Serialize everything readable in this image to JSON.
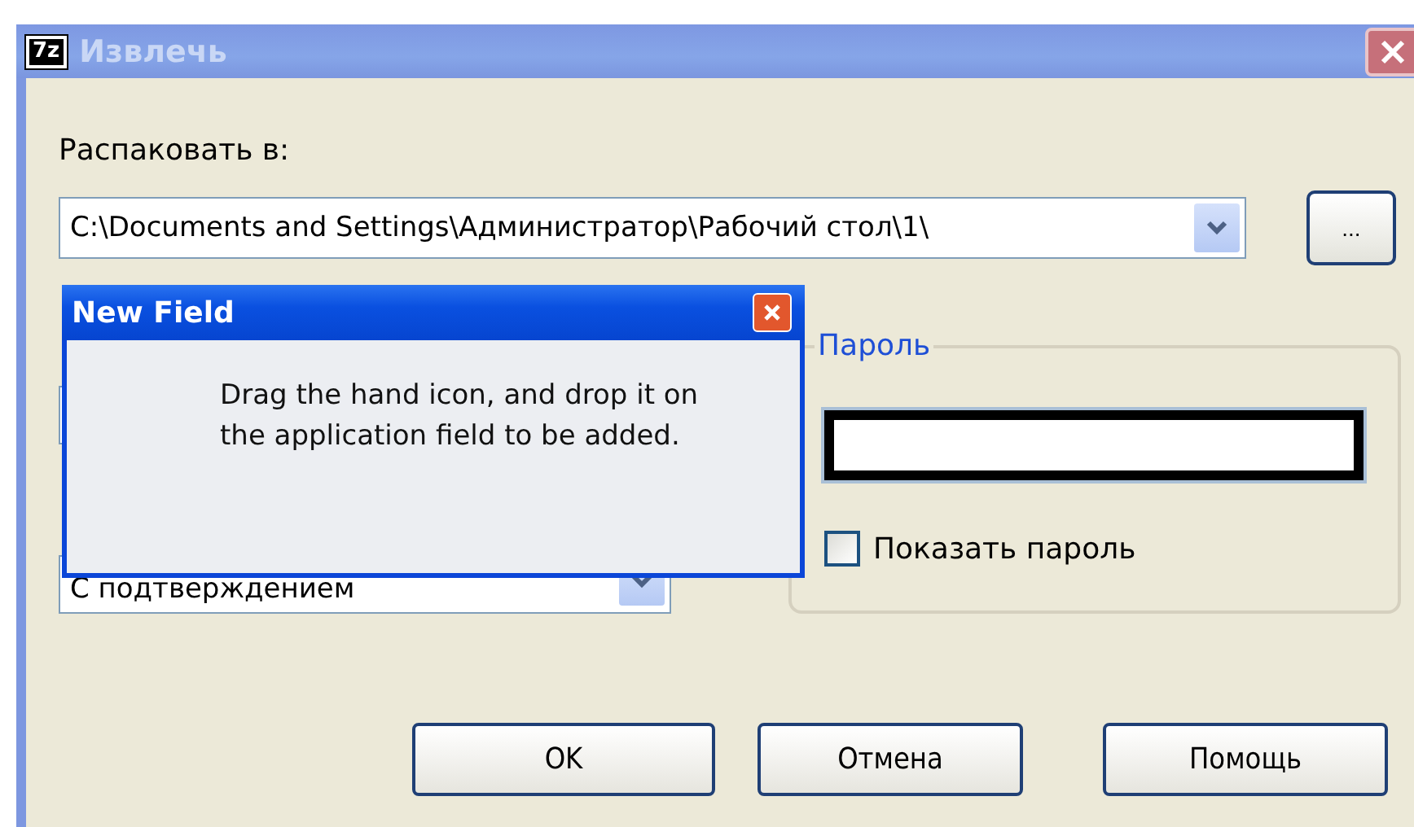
{
  "window": {
    "title": "Извлечь",
    "icon_text": "7z"
  },
  "extract_to": {
    "label": "Распаковать в:",
    "value": "C:\\Documents and Settings\\Администратор\\Рабочий стол\\1\\"
  },
  "browse_button": "...",
  "overwrite": {
    "value": "С подтверждением"
  },
  "password": {
    "label": "Пароль",
    "show_password": {
      "label": "Показать пароль",
      "checked": false
    }
  },
  "buttons": [
    "OK",
    "Отмена",
    "Помощь"
  ],
  "popup": {
    "title": "New Field",
    "message": "Drag the hand icon, and drop it on the application field to be added."
  }
}
